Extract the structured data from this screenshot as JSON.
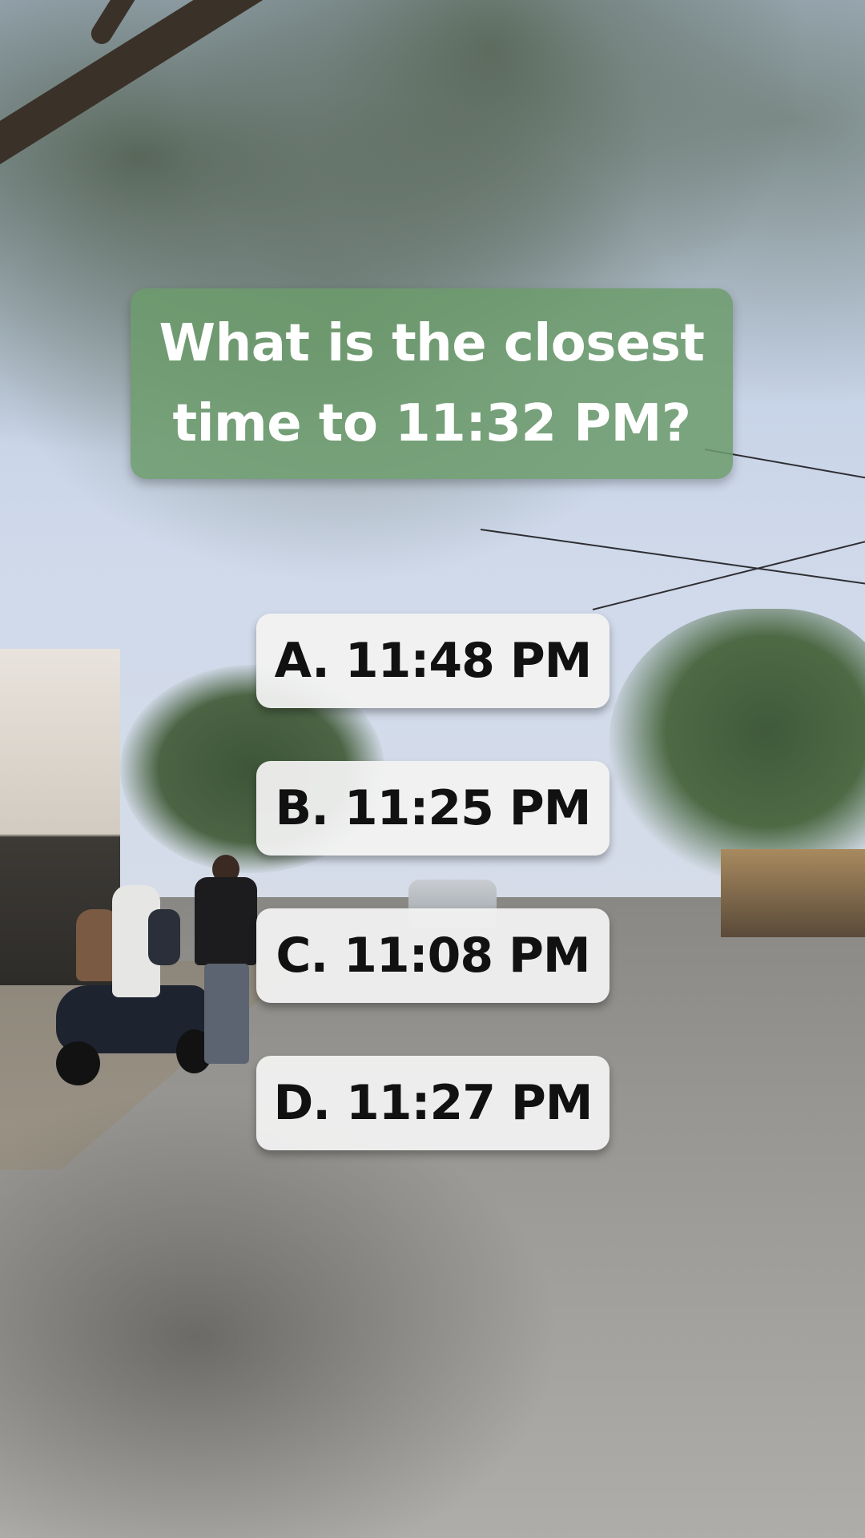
{
  "question": {
    "text": "What is the closest time to 11:32 PM?"
  },
  "answers": [
    {
      "label": "A. 11:48 PM"
    },
    {
      "label": "B. 11:25 PM"
    },
    {
      "label": "C. 11:08 PM"
    },
    {
      "label": "D. 11:27 PM"
    }
  ],
  "colors": {
    "question_box": "#6c9c6c",
    "answer_box": "#f2f2f2",
    "answer_text": "#111111",
    "question_text": "#ffffff"
  }
}
